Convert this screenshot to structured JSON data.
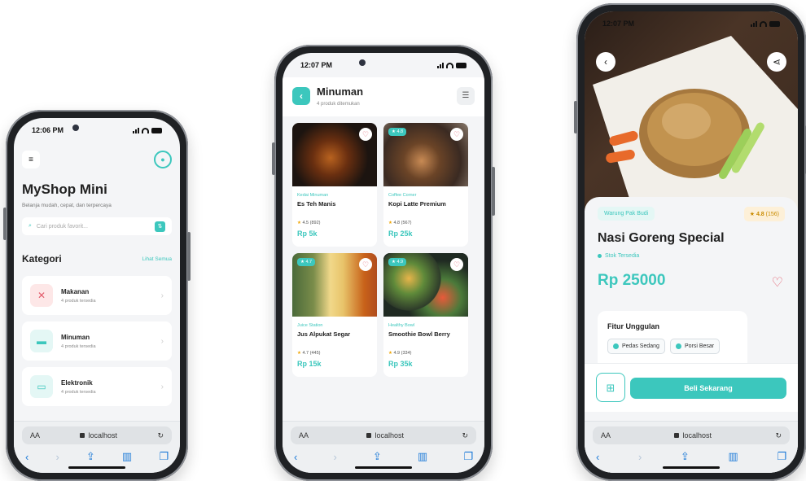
{
  "phone1": {
    "time": "12:06 PM",
    "title": "MyShop Mini",
    "subtitle": "Belanja mudah, cepat, dan terpercaya",
    "search_placeholder": "Cari produk favorit...",
    "section_title": "Kategori",
    "see_all": "Lihat Semua",
    "categories": [
      {
        "name": "Makanan",
        "count": "4 produk tersedia",
        "icon": "utensils-icon",
        "bg": "#fde7e7",
        "fg": "#e25a6a"
      },
      {
        "name": "Minuman",
        "count": "4 produk tersedia",
        "icon": "cup-icon",
        "bg": "#e4f7f5",
        "fg": "#3cc7bd"
      },
      {
        "name": "Elektronik",
        "count": "4 produk tersedia",
        "icon": "device-icon",
        "bg": "#e4f7f5",
        "fg": "#3cc7bd"
      }
    ],
    "url": "localhost"
  },
  "phone2": {
    "time": "12:07 PM",
    "title": "Minuman",
    "subtitle": "4 produk ditemukan",
    "products": [
      {
        "shop": "Kedai Minuman",
        "name": "Es Teh Manis",
        "rating": "4.5",
        "reviews": "(892)",
        "price": "Rp 5k",
        "badge": ""
      },
      {
        "shop": "Coffee Corner",
        "name": "Kopi Latte Premium",
        "rating": "4.8",
        "reviews": "(567)",
        "price": "Rp 25k",
        "badge": "4.8"
      },
      {
        "shop": "Juice Station",
        "name": "Jus Alpukat Segar",
        "rating": "4.7",
        "reviews": "(445)",
        "price": "Rp 15k",
        "badge": "4.7"
      },
      {
        "shop": "Healthy Bowl",
        "name": "Smoothie Bowl Berry",
        "rating": "4.9",
        "reviews": "(334)",
        "price": "Rp 35k",
        "badge": "4.9"
      }
    ],
    "url": "localhost"
  },
  "phone3": {
    "time": "12:07 PM",
    "shop": "Warung Pak Budi",
    "rating": "4.8",
    "reviews": "(156)",
    "title": "Nasi Goreng Special",
    "stock": "Stok Tersedia",
    "price": "Rp 25000",
    "features_title": "Fitur Unggulan",
    "features": [
      "Pedas Sedang",
      "Porsi Besar"
    ],
    "buy_label": "Beli Sekarang",
    "url": "localhost"
  },
  "colors": {
    "accent": "#3cc7bd",
    "heart": "#e25a6a",
    "star": "#f0a500"
  }
}
